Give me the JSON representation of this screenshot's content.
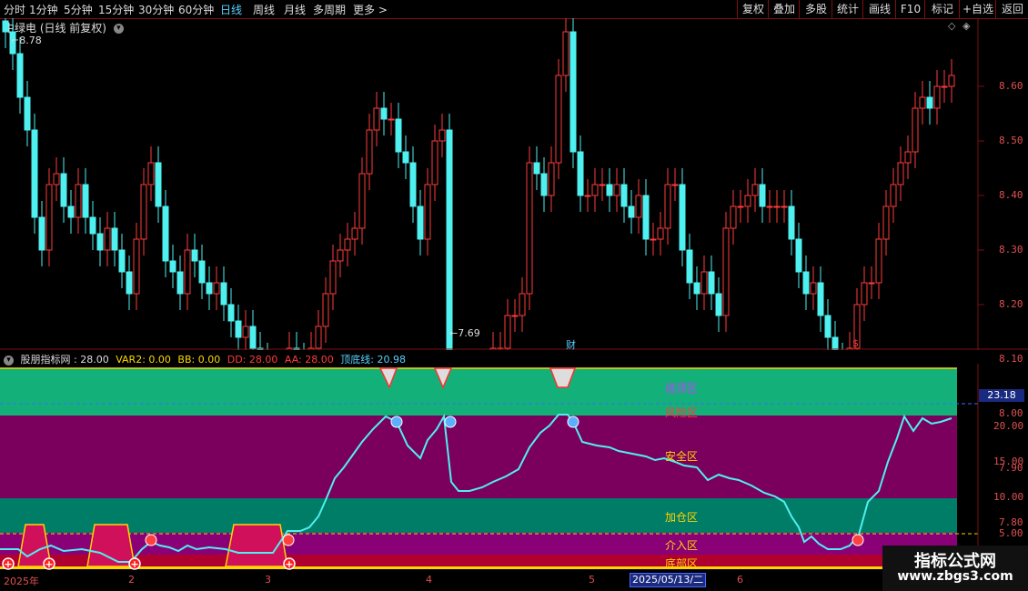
{
  "toolbar": {
    "periods": [
      "分时",
      "1分钟",
      "5分钟",
      "15分钟",
      "30分钟",
      "60分钟",
      "日线",
      "周线",
      "月线",
      "多周期",
      "更多 >"
    ],
    "active_period": "日线",
    "right_buttons": [
      "复权",
      "叠加",
      "多股",
      "统计",
      "画线",
      "F10",
      "+自选",
      "返回",
      "标记"
    ]
  },
  "main_chart": {
    "title": "中绿电 (日线 前复权)",
    "y_ticks": [
      "8.60",
      "8.50",
      "8.40",
      "8.30",
      "8.20",
      "8.10",
      "8.00",
      "7.90",
      "7.80"
    ],
    "y_tick_values": [
      8.6,
      8.5,
      8.4,
      8.3,
      8.2,
      8.1,
      8.0,
      7.9,
      7.8
    ],
    "high_label": "8.78",
    "low_label": "7.69",
    "marker_cai": "财",
    "marker_s": "$",
    "colors": {
      "up": "#ff3b3b",
      "down": "#4ef0f0",
      "grid": "#7a1010"
    }
  },
  "indicator": {
    "name": "股朋指标网",
    "value": "28.00",
    "var2_label": "VAR2:",
    "var2": "0.00",
    "bb_label": "BB:",
    "bb": "0.00",
    "dd_label": "DD:",
    "dd": "28.00",
    "aa_label": "AA:",
    "aa": "28.00",
    "line_label": "顶底线:",
    "line_value": "20.98",
    "current_marker": "23.18",
    "y_ticks": [
      "20.00",
      "15.00",
      "10.00",
      "5.00"
    ],
    "zones": {
      "escape": "逃顶区",
      "risk": "风险区",
      "safe": "安全区",
      "add": "加仓区",
      "entry": "介入区",
      "bottom": "底部区"
    }
  },
  "dates": {
    "year": "2025年",
    "months": [
      "2",
      "3",
      "4",
      "5",
      "6"
    ],
    "cursor": "2025/05/13/二"
  },
  "watermark": {
    "title": "指标公式网",
    "url": "www.zbgs3.com"
  }
}
